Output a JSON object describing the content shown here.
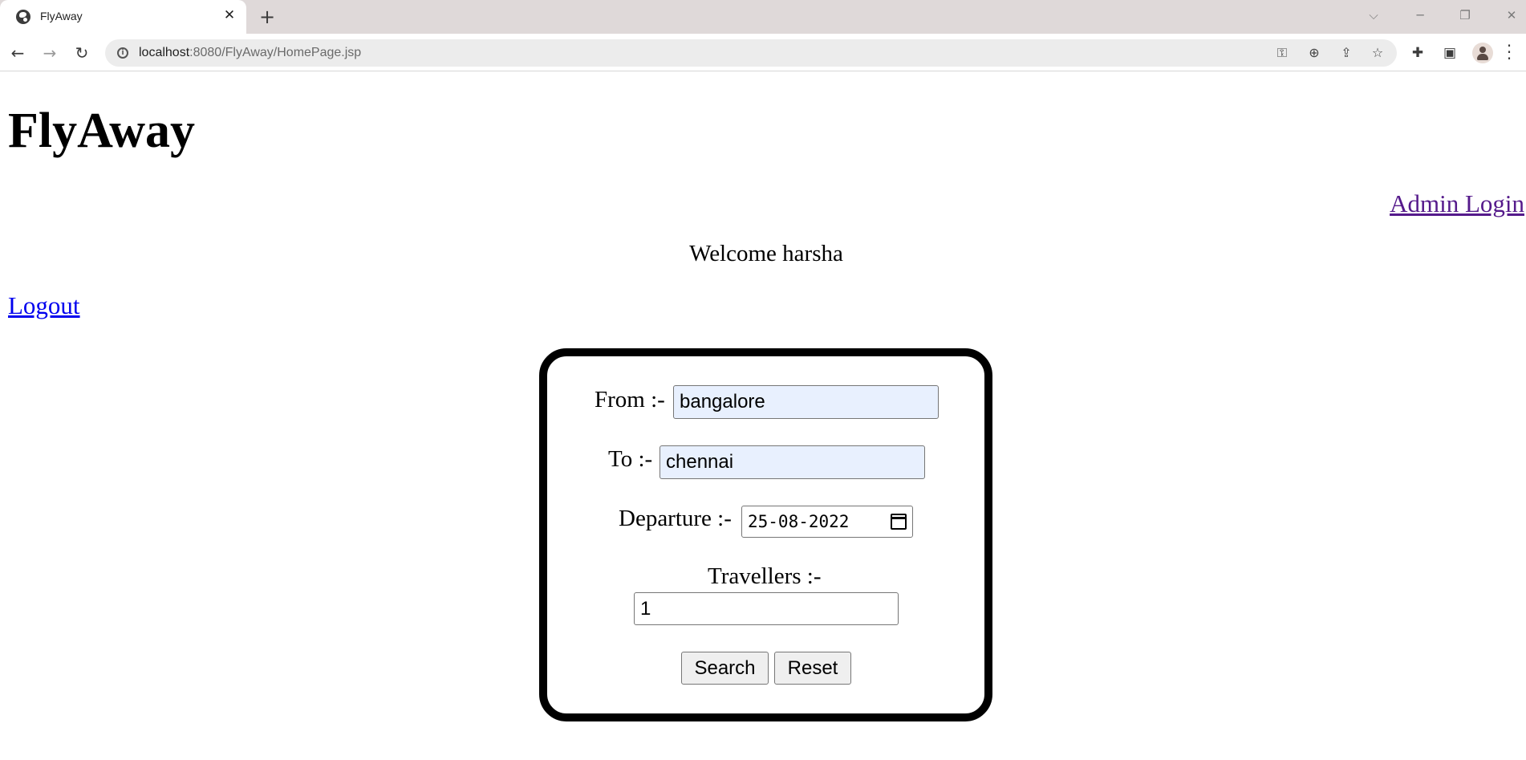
{
  "browser": {
    "tab_title": "FlyAway",
    "new_tab_symbol": "+",
    "close_tab_symbol": "✕",
    "url_host": "localhost",
    "url_rest": ":8080/FlyAway/HomePage.jsp",
    "icons": [
      "globe-icon",
      "back-arrow-icon",
      "forward-arrow-icon",
      "reload-icon",
      "info-icon",
      "key-icon",
      "zoom-icon",
      "share-icon",
      "star-icon",
      "extensions-icon",
      "side-panel-icon",
      "profile-icon",
      "menu-icon"
    ]
  },
  "page": {
    "site_title": "FlyAway",
    "admin_login_label": "Admin Login",
    "welcome_text": "Welcome harsha",
    "logout_label": "Logout"
  },
  "form": {
    "from_label": "From :-",
    "from_value": "bangalore",
    "to_label": "To :-",
    "to_value": "chennai",
    "departure_label": "Departure :-",
    "departure_value": "25-08-2022",
    "travellers_label": "Travellers :-",
    "travellers_value": "1",
    "search_label": "Search",
    "reset_label": "Reset"
  },
  "colors": {
    "autofill_bg": "#e8f0fe",
    "visited_link": "#551a8b",
    "link": "#0000ee",
    "panel_border": "#000000"
  }
}
